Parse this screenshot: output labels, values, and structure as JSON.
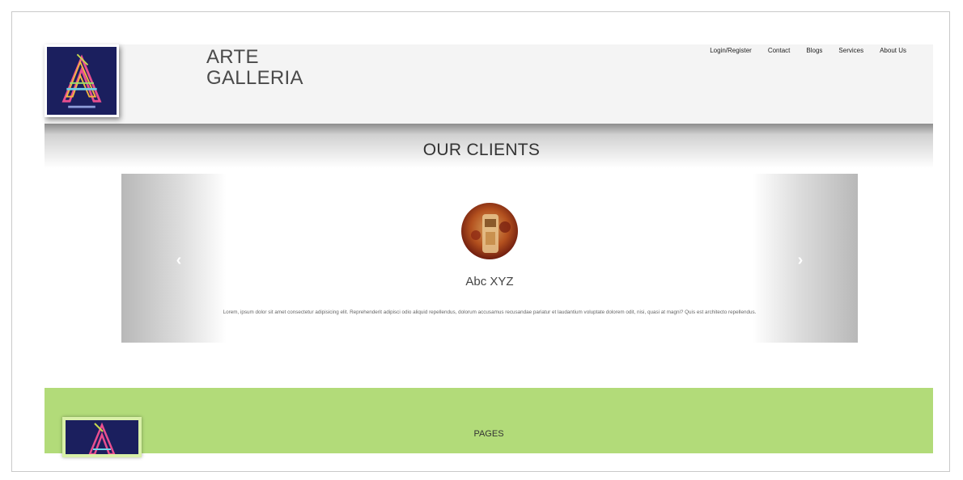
{
  "header": {
    "brand_line1": "ARTE",
    "brand_line2": "GALLERIA",
    "nav": [
      "Login/Register",
      "Contact",
      "Blogs",
      "Services",
      "About Us"
    ]
  },
  "clients": {
    "title": "OUR CLIENTS",
    "prev_icon": "‹",
    "next_icon": "›",
    "client_name": "Abc XYZ",
    "testimonial": "Lorem, ipsum dolor sit amet consectetur adipisicing elit. Reprehenderit adipisci odio aliquid repellendus, dolorum accusamus recusandae pariatur et laudantium voluptate dolorem odit, nisi, quasi at magni? Quis est architecto repellendus."
  },
  "footer": {
    "title": "PAGES"
  },
  "colors": {
    "header_bg": "#f4f4f4",
    "logo_bg": "#1b1f5e",
    "footer_bg": "#b2db79"
  }
}
